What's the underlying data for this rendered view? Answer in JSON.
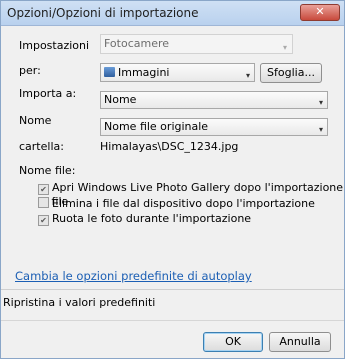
{
  "window": {
    "title": "Opzioni/Opzioni di importazione",
    "close_label": "✕"
  },
  "settings_for": {
    "label_line1": "Impostazioni",
    "label_line2": "per:",
    "device_value": "Fotocamere",
    "source_value": "Immagini",
    "browse_label": "Sfoglia..."
  },
  "import_to": {
    "label": "Importa a:",
    "value": "Nome"
  },
  "folder_name": {
    "label_line1": "Nome",
    "label_line2": "cartella:",
    "value": "Nome file originale",
    "example": "Himalayas\\DSC_1234.jpg"
  },
  "file_name": {
    "label": "Nome file:"
  },
  "options": [
    {
      "label": "Apri Windows Live Photo Gallery dopo l'importazione di file",
      "checked": true
    },
    {
      "label": "Elimina i file dal dispositivo dopo l'importazione",
      "checked": false
    },
    {
      "label": "Ruota le foto durante l'importazione",
      "checked": true
    }
  ],
  "autoplay_link": "Cambia le opzioni predefinite di autoplay",
  "restore_defaults": "Ripristina i valori predefiniti",
  "buttons": {
    "ok": "OK",
    "cancel": "Annulla"
  }
}
